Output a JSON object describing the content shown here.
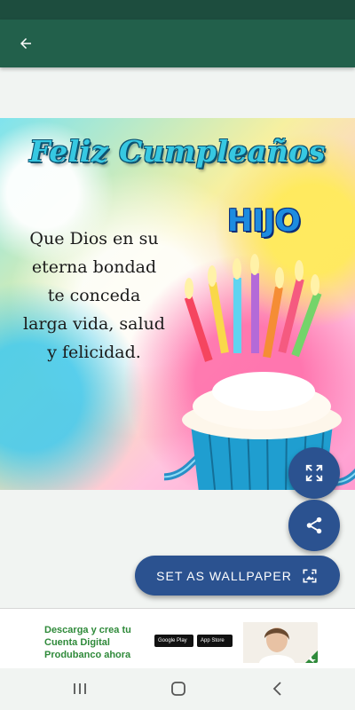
{
  "app_bar": {
    "back_icon": "arrow-back-icon"
  },
  "card": {
    "title": "Feliz Cumpleaños",
    "subtitle": "HIJO",
    "message": "Que Dios en su\neterna bondad\nte conceda\nlarga vida, salud\ny felicidad."
  },
  "actions": {
    "fullscreen_icon": "fullscreen-icon",
    "share_icon": "share-icon",
    "set_wallpaper_label": "SET AS WALLPAPER",
    "wallpaper_icon": "wallpaper-icon"
  },
  "ad": {
    "text": "Descarga y crea tu Cuenta Digital Produbanco ahora",
    "google_play": "Google Play",
    "app_store": "App Store"
  },
  "nav": {
    "recent_icon": "recent-apps-icon",
    "home_icon": "home-icon",
    "back_icon": "back-icon"
  },
  "colors": {
    "app_bar": "#22604b",
    "status_bar": "#1d4d3e",
    "accent": "#2b5290"
  }
}
